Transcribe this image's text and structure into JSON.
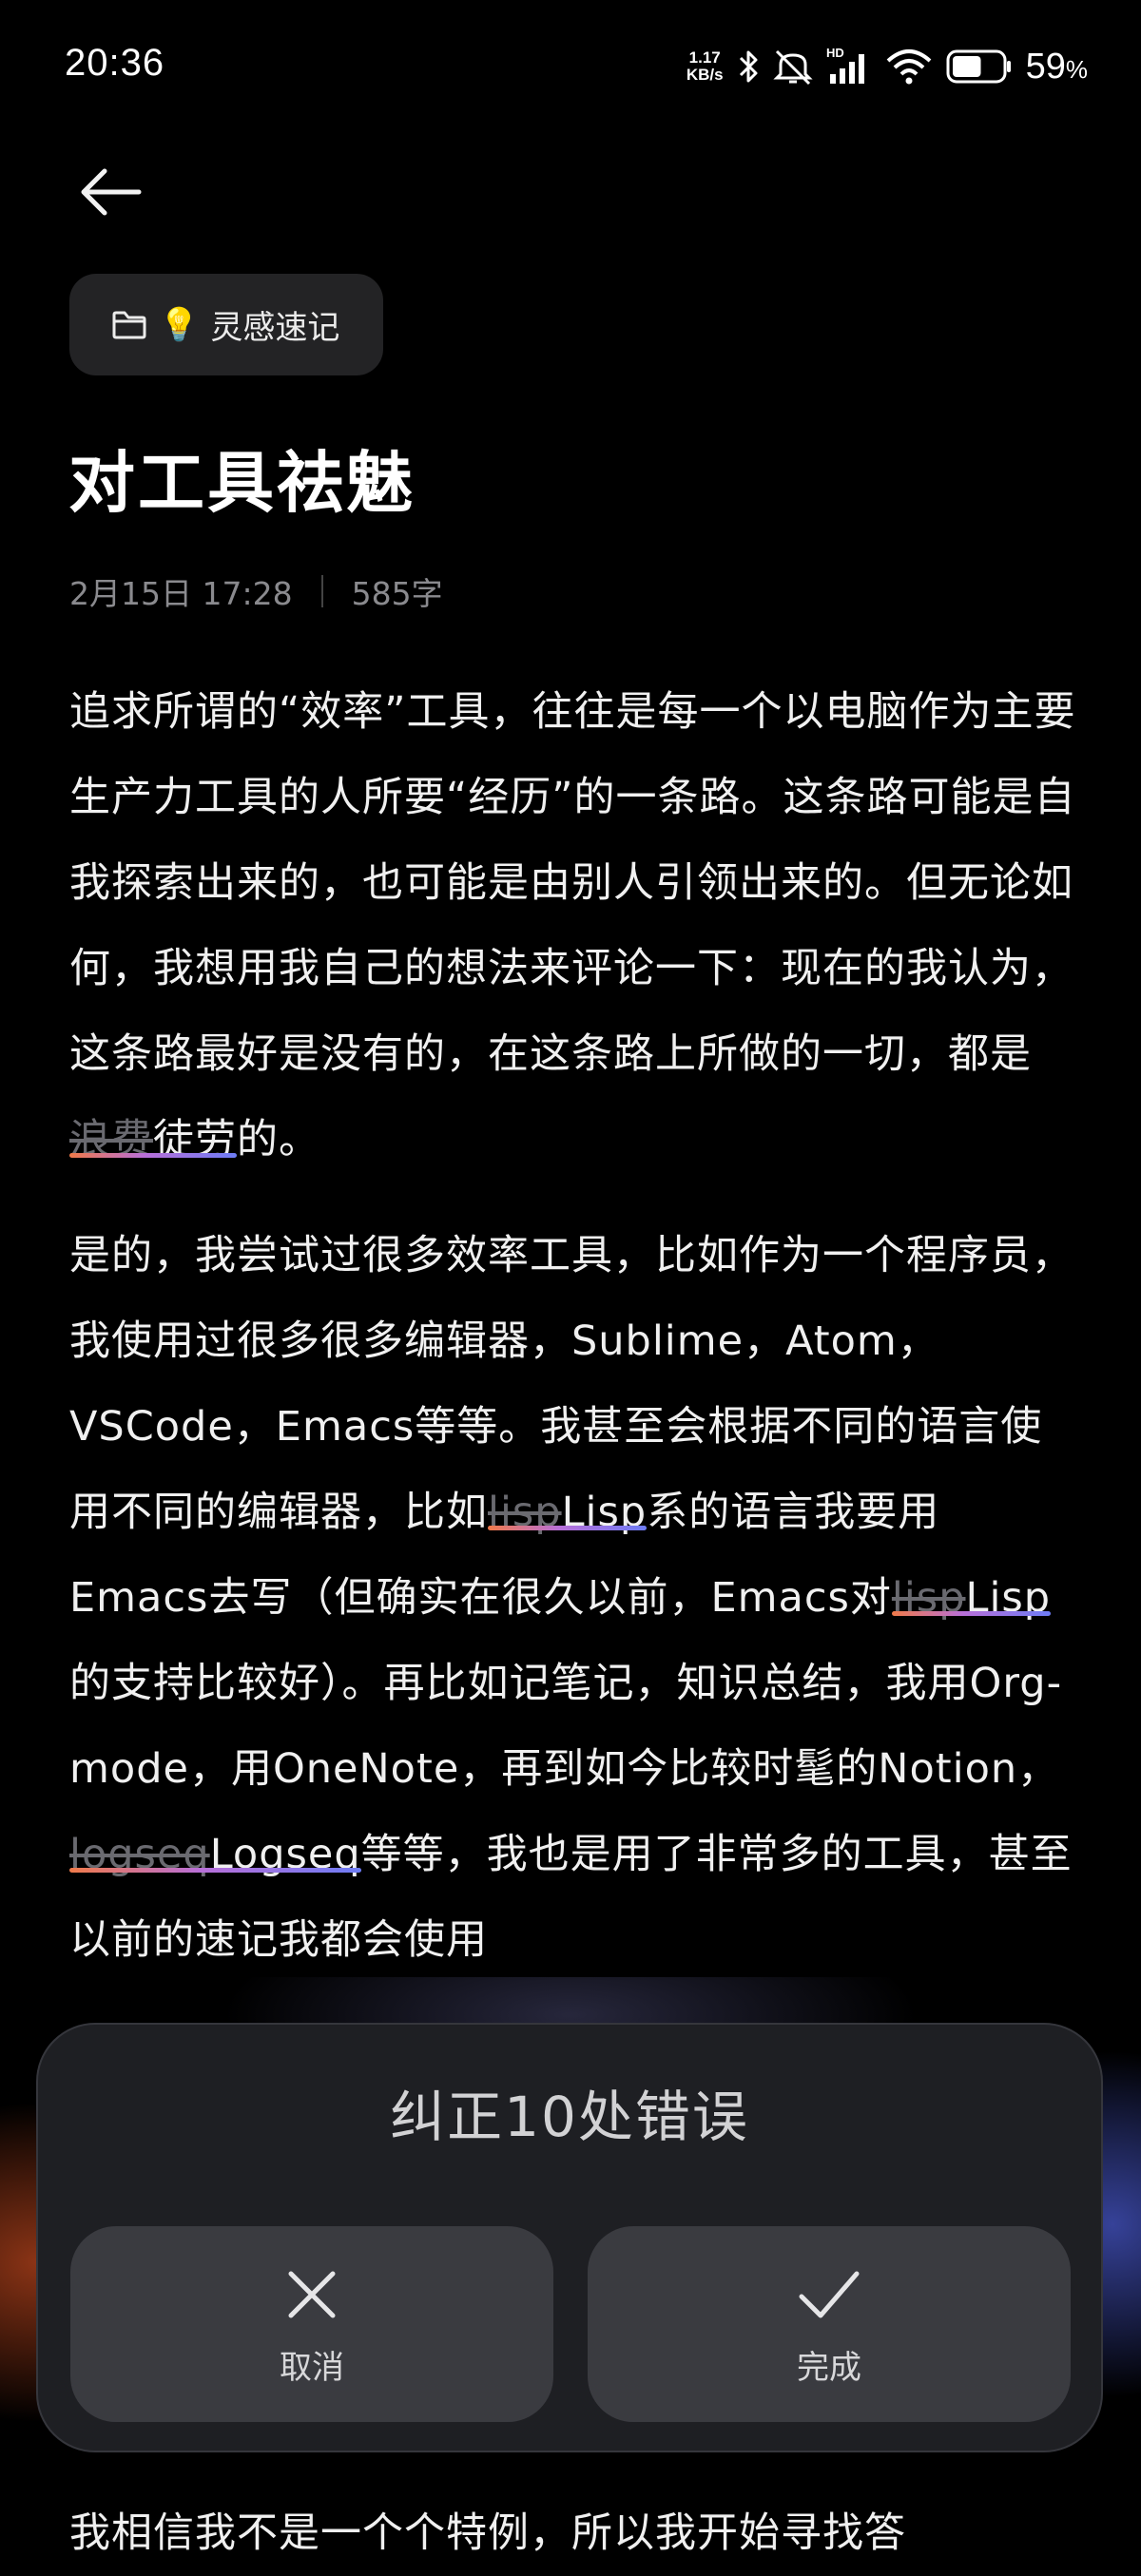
{
  "status_bar": {
    "time": "20:36",
    "net_speed_value": "1.17",
    "net_speed_unit": "KB/s",
    "network_label": "HD",
    "battery_value": "59",
    "battery_unit": "%",
    "battery_level": 0.59
  },
  "header": {
    "folder_emoji": "💡",
    "folder_name": "灵感速记"
  },
  "note": {
    "title": "对工具祛魅",
    "date": "2月15日 17:28",
    "word_count": "585字",
    "p1": {
      "t1": "追求所谓的“效率”工具，往往是每一个以电脑作为主要生产力工具的人所要“经历”的一条路。这条路可能是自我探索出来的，也可能是由别人引领出来的。但无论如何，我想用我自己的想法来评论一下：现在的我认为，这条路最好是没有的，在这条路上所做的一切，都是",
      "c1_wrong": "浪费",
      "c1_right": "徒劳",
      "t2": "的。"
    },
    "p2": {
      "t1": "是的，我尝试过很多效率工具，比如作为一个程序员，我使用过很多很多编辑器，Sublime，Atom，VSCode，Emacs等等。我甚至会根据不同的语言使用不同的编辑器，比如",
      "c1_wrong": "lisp",
      "c1_right": "Lisp",
      "t2": "系的语言我要用Emacs去写（但确实在很久以前，Emacs对",
      "c2_wrong": "lisp",
      "c2_right": "Lisp",
      "t3": "的支持比较好）。再比如记笔记，知识总结，我用Org-mode，用OneNote，再到如今比较时髦的Notion，",
      "c3_wrong": "logseq",
      "c3_right": "Logseq",
      "t4": "等等，我也是用了非常多的工具，甚至以前的速记我都会使用"
    },
    "tail_line": "我相信我不是一个个特例，所以我开始寻找答"
  },
  "correction_panel": {
    "title": "纠正10处错误",
    "cancel_label": "取消",
    "done_label": "完成"
  }
}
